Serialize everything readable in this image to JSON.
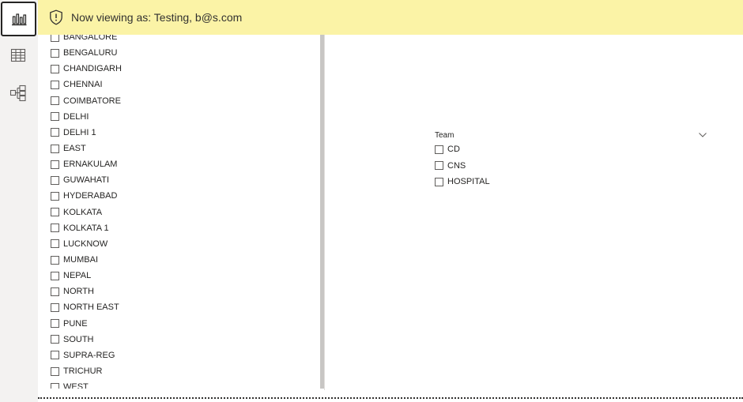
{
  "banner": {
    "text": "Now viewing as: Testing, b@s.com"
  },
  "rail": {
    "items": [
      {
        "icon": "bar-chart-icon",
        "active": true
      },
      {
        "icon": "table-icon",
        "active": false
      },
      {
        "icon": "model-icon",
        "active": false
      }
    ]
  },
  "city_slicer": {
    "items": [
      "BANGALORE",
      "BENGALURU",
      "CHANDIGARH",
      "CHENNAI",
      "COIMBATORE",
      "DELHI",
      "DELHI 1",
      "EAST",
      "ERNAKULAM",
      "GUWAHATI",
      "HYDERABAD",
      "KOLKATA",
      "KOLKATA 1",
      "LUCKNOW",
      "MUMBAI",
      "NEPAL",
      "NORTH",
      "NORTH EAST",
      "PUNE",
      "SOUTH",
      "SUPRA-REG",
      "TRICHUR",
      "WEST"
    ]
  },
  "team_slicer": {
    "title": "Team",
    "items": [
      "CD",
      "CNS",
      "HOSPITAL"
    ]
  },
  "colors": {
    "banner_bg": "#fbf3a6",
    "rail_bg": "#f3f2f1",
    "scrollbar": "#c8c6c4"
  }
}
